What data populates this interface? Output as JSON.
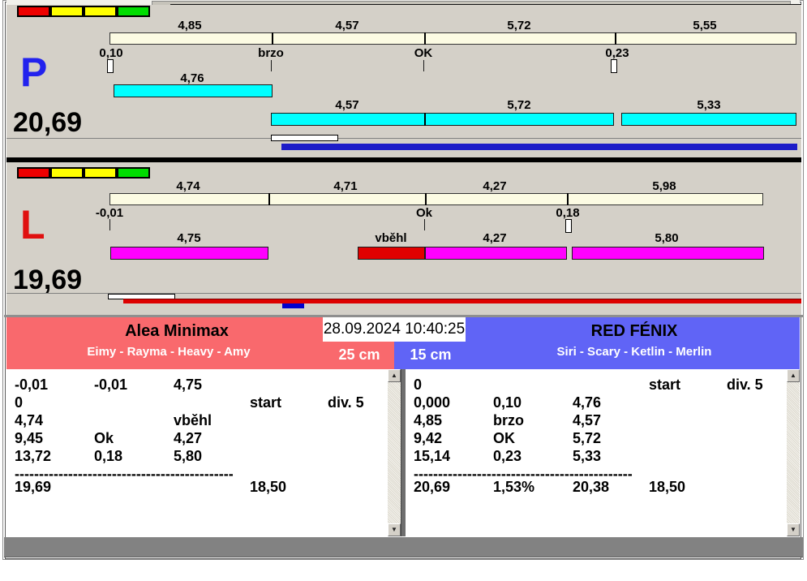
{
  "colors": {
    "panel_bg": "#d4d0c8",
    "split_bar": "#fcfbe3",
    "cyan_bar": "#00ffff",
    "magenta_bar": "#ff00ff",
    "fault_bar": "#e10000",
    "progress_bar_blue": "#1c1cc8",
    "progress_bar_red": "#dd0000",
    "team_left_bg": "#f9696d",
    "team_right_bg": "#6064f6",
    "lane_p_color": "#2222ee",
    "lane_l_color": "#e01010",
    "bottom_bar": "#828282"
  },
  "status_squares": [
    "red",
    "yellow",
    "yellow",
    "green"
  ],
  "icons": {
    "scroll_up": "▲",
    "scroll_down": "▼"
  },
  "datetime": "28.09.2024 10:40:25",
  "lane_p": {
    "label": "P",
    "total": "20,69",
    "split_segments": [
      {
        "label": "4,85"
      },
      {
        "label": "4,57"
      },
      {
        "label": "5,72"
      },
      {
        "label": "5,55"
      }
    ],
    "markers": [
      {
        "label": "0,10"
      },
      {
        "label": "brzo"
      },
      {
        "label": "OK"
      },
      {
        "label": "0,23"
      }
    ],
    "dog_segments": [
      {
        "label": "4,76"
      },
      {
        "label": "4,57"
      },
      {
        "label": "5,72"
      },
      {
        "label": "5,33"
      }
    ]
  },
  "lane_l": {
    "label": "L",
    "total": "19,69",
    "split_segments": [
      {
        "label": "4,74"
      },
      {
        "label": "4,71"
      },
      {
        "label": "4,27"
      },
      {
        "label": "5,98"
      }
    ],
    "markers": [
      {
        "label": "-0,01"
      },
      {
        "label": "Ok"
      },
      {
        "label": "0,18"
      }
    ],
    "dog_segments": [
      {
        "label": "4,75"
      },
      {
        "label": "vběhl"
      },
      {
        "label": "4,27"
      },
      {
        "label": "5,80"
      }
    ]
  },
  "team_left": {
    "name": "Alea Minimax",
    "dogs": "Eimy - Rayma - Heavy - Amy",
    "category": "25 cm",
    "rows": [
      [
        "-0,01",
        "-0,01",
        "4,75",
        "",
        ""
      ],
      [
        "0",
        "",
        "",
        "start",
        "div. 5"
      ],
      [
        "4,74",
        "",
        "vběhl",
        "",
        ""
      ],
      [
        "9,45",
        "Ok",
        "4,27",
        "",
        ""
      ],
      [
        "13,72",
        "0,18",
        "5,80",
        "",
        ""
      ]
    ],
    "divider": "---------------------------------------------",
    "totals": [
      "19,69",
      "",
      "",
      "18,50",
      ""
    ]
  },
  "team_right": {
    "name": "RED FÉNIX",
    "dogs": "Siri - Scary - Ketlin - Merlin",
    "category": "15 cm",
    "rows": [
      [
        "0",
        "",
        "",
        "start",
        "div. 5"
      ],
      [
        "0,000",
        "0,10",
        "4,76",
        "",
        ""
      ],
      [
        "4,85",
        "brzo",
        "4,57",
        "",
        ""
      ],
      [
        "9,42",
        "OK",
        "5,72",
        "",
        ""
      ],
      [
        "15,14",
        "0,23",
        "5,33",
        "",
        ""
      ]
    ],
    "divider": "---------------------------------------------",
    "totals": [
      "20,69",
      "1,53%",
      "20,38",
      "18,50",
      ""
    ]
  }
}
